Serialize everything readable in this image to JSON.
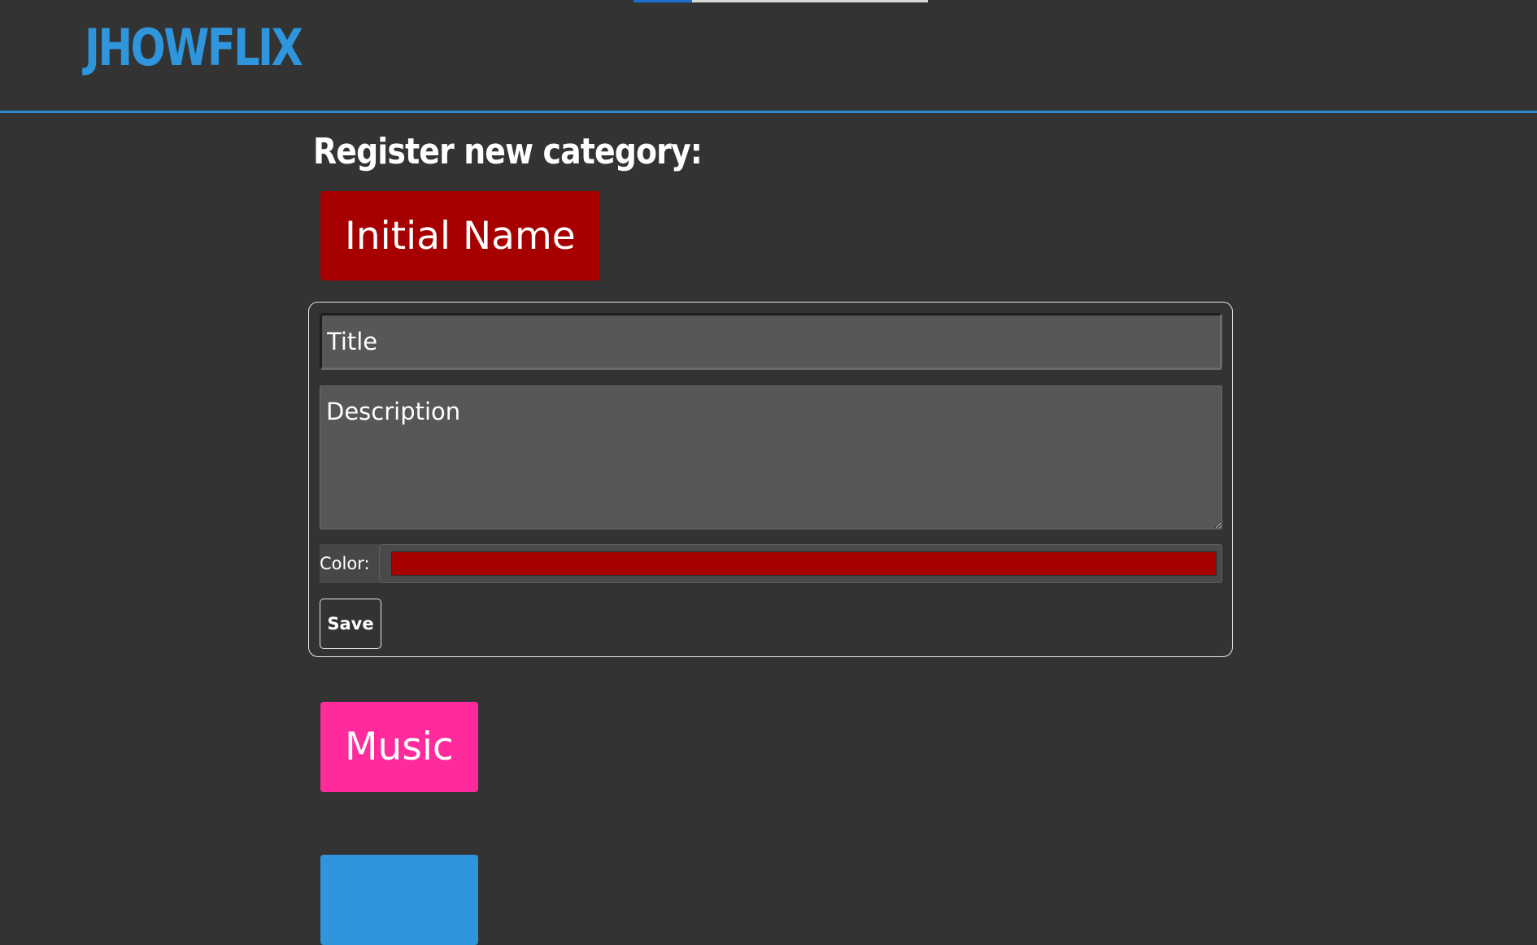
{
  "progress": {
    "fraction": 0.2
  },
  "header": {
    "logo_text": "JHOWFLIX"
  },
  "page": {
    "title": "Register new category:"
  },
  "preview": {
    "label": "Initial Name",
    "color": "#a70000"
  },
  "form": {
    "title_placeholder": "Title",
    "description_placeholder": "Description",
    "color_label": "Color:",
    "color_value": "#a70000",
    "save_label": "Save"
  },
  "categories": [
    {
      "name": "Music",
      "color": "#ff2a9b"
    },
    {
      "name": "",
      "color": "#2f95dc"
    }
  ],
  "colors": {
    "background": "#333333",
    "accent": "#2f95dc"
  }
}
